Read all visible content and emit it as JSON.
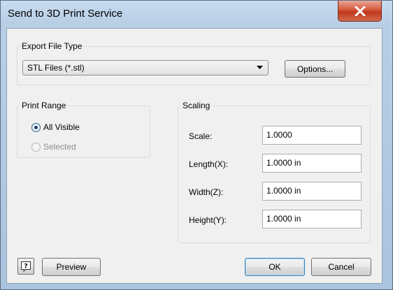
{
  "window": {
    "title": "Send to 3D Print Service"
  },
  "export_group": {
    "label": "Export File Type",
    "file_type_selected": "STL Files (*.stl)",
    "options_button": "Options..."
  },
  "print_range": {
    "label": "Print Range",
    "options": [
      {
        "label": "All Visible",
        "checked": true,
        "enabled": true
      },
      {
        "label": "Selected",
        "checked": false,
        "enabled": false
      }
    ]
  },
  "scaling": {
    "label": "Scaling",
    "fields": [
      {
        "label": "Scale:",
        "value": "1.0000"
      },
      {
        "label": "Length(X):",
        "value": "1.0000 in"
      },
      {
        "label": "Width(Z):",
        "value": "1.0000 in"
      },
      {
        "label": "Height(Y):",
        "value": "1.0000 in"
      }
    ]
  },
  "footer": {
    "help_icon_glyph": "?",
    "preview_button": "Preview",
    "ok_button": "OK",
    "cancel_button": "Cancel"
  },
  "icons": {
    "close": "close-icon",
    "dropdown": "chevron-down-icon",
    "help": "help-icon"
  },
  "colors": {
    "close_button": "#c7472a",
    "titlebar": "#b9cfe6",
    "client_bg": "#f0f0f0",
    "default_button_border": "#3c7fb1"
  }
}
